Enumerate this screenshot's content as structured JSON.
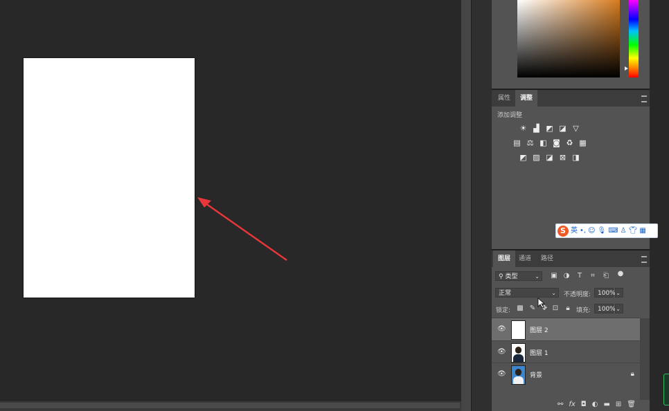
{
  "adjustments_panel": {
    "tabs": [
      {
        "label": "属性",
        "active": false
      },
      {
        "label": "调整",
        "active": true
      }
    ],
    "add_adjustment_label": "添加调整",
    "icon_rows": [
      [
        "brightness-contrast-icon",
        "levels-icon",
        "curves-icon",
        "exposure-icon",
        "vibrance-icon"
      ],
      [
        "hue-saturation-icon",
        "color-balance-icon",
        "black-white-icon",
        "photo-filter-icon",
        "channel-mixer-icon",
        "color-lookup-icon"
      ],
      [
        "invert-icon",
        "posterize-icon",
        "threshold-icon",
        "selective-color-icon",
        "gradient-map-icon"
      ]
    ]
  },
  "ime_toolbar": {
    "logo": "S",
    "mode_label": "英",
    "icons": [
      "punctuation-icon",
      "emoji-icon",
      "mic-icon",
      "keyboard-icon",
      "user-icon",
      "skin-icon",
      "grid-icon"
    ]
  },
  "layers_panel": {
    "tabs": [
      {
        "label": "图层",
        "active": true
      },
      {
        "label": "通道",
        "active": false
      },
      {
        "label": "路径",
        "active": false
      }
    ],
    "filter_label": "类型",
    "blend_mode": "正常",
    "opacity_label": "不透明度:",
    "opacity_value": "100%",
    "lock_label": "锁定:",
    "fill_label": "填充:",
    "fill_value": "100%",
    "layers": [
      {
        "name": "图层 2",
        "selected": true,
        "thumbnail": "blank",
        "locked": false
      },
      {
        "name": "图层 1",
        "selected": false,
        "thumbnail": "portrait-white",
        "locked": false
      },
      {
        "name": "背景",
        "selected": false,
        "thumbnail": "portrait-blue",
        "locked": true
      }
    ],
    "footer_icons": [
      "link-icon",
      "fx-icon",
      "mask-icon",
      "adjustment-icon",
      "folder-icon",
      "new-layer-icon",
      "trash-icon"
    ]
  },
  "colors": {
    "annotation_arrow": "#e8373a",
    "panel_bg": "#535353",
    "workspace_bg": "#282828"
  }
}
